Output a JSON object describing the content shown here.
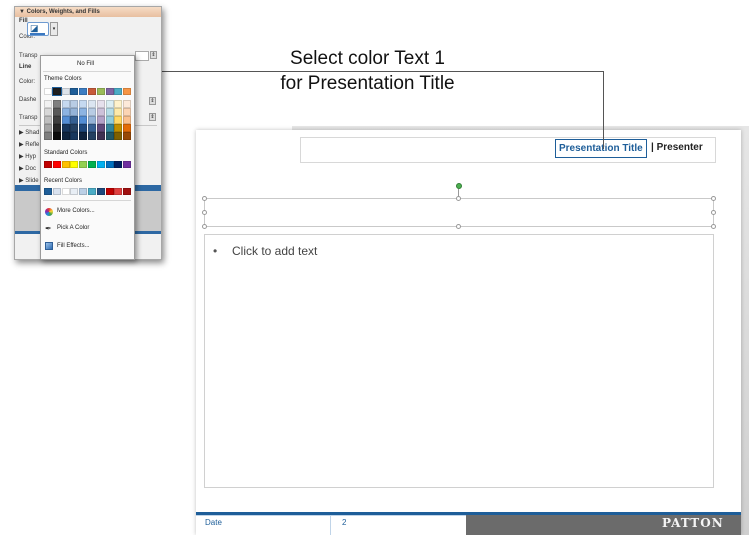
{
  "callout": {
    "line1": "Select color Text 1",
    "line2": "for Presentation Title"
  },
  "slide": {
    "header": {
      "title": "Presentation Title",
      "separator": "|",
      "presenter": "Presenter"
    },
    "content": {
      "bullet": "•",
      "placeholder": "Click to add text"
    },
    "footer": {
      "date": "Date",
      "page": "2",
      "logo": "PATTON"
    }
  },
  "panel": {
    "section_title": "▼ Colors, Weights, and Fills",
    "fill_label": "Fill",
    "color_label": "Color:",
    "transparency_label": "Transp",
    "line_label": "Line",
    "line_color_label": "Color:",
    "dashes_label": "Dashe",
    "line_transparency_label": "Transp",
    "collapsed_sections": [
      "▶ Shad",
      "▶ Refle",
      "▶ Hyp",
      "▶ Doc",
      "▶ Slide"
    ]
  },
  "color_menu": {
    "no_fill": "No Fill",
    "theme_colors_label": "Theme Colors",
    "standard_colors_label": "Standard Colors",
    "recent_colors_label": "Recent Colors",
    "more_colors": "More Colors...",
    "pick_color": "Pick A Color",
    "fill_effects": "Fill Effects...",
    "theme_top_row": [
      "#ffffff",
      "#1f1f1f",
      "#dde3ea",
      "#1e5e99",
      "#3d7dc2",
      "#c75b3a",
      "#9bbb59",
      "#8064a2",
      "#4bacc6",
      "#f79646"
    ],
    "theme_columns": [
      [
        "#f2f2f2",
        "#d8d8d8",
        "#bfbfbf",
        "#a5a5a5",
        "#7f7f7f"
      ],
      [
        "#7f7f7f",
        "#595959",
        "#3f3f3f",
        "#262626",
        "#0c0c0c"
      ],
      [
        "#c6d9f0",
        "#8db3e2",
        "#548dd4",
        "#17365d",
        "#0f243e"
      ],
      [
        "#b8cce4",
        "#95b3d7",
        "#366092",
        "#244061",
        "#17375d"
      ],
      [
        "#c5d9f1",
        "#8db4e2",
        "#538ed5",
        "#1f497d",
        "#10243e"
      ],
      [
        "#dbe5f1",
        "#b8cce4",
        "#95b3d7",
        "#366092",
        "#244061"
      ],
      [
        "#e5e0ec",
        "#ccc1d9",
        "#b2a1c7",
        "#5f497a",
        "#3f3151"
      ],
      [
        "#dbeef3",
        "#b7dde8",
        "#92cddc",
        "#31859b",
        "#205867"
      ],
      [
        "#fef2cb",
        "#fde9a9",
        "#ffd966",
        "#bf8f00",
        "#7f6000"
      ],
      [
        "#fde9d9",
        "#fbd4b4",
        "#fac08f",
        "#e36c09",
        "#974806"
      ]
    ],
    "standard_colors": [
      "#c00000",
      "#ff0000",
      "#ffc000",
      "#ffff00",
      "#92d050",
      "#00b050",
      "#00b0f0",
      "#0070c0",
      "#002060",
      "#7030a0"
    ],
    "recent_colors": [
      "#1e5e99",
      "#d9e2ef",
      "#ffffff",
      "#e8eef5",
      "#bcd0e6",
      "#4bacc6",
      "#1f497d",
      "#c00000",
      "#e04040",
      "#a01010"
    ]
  }
}
